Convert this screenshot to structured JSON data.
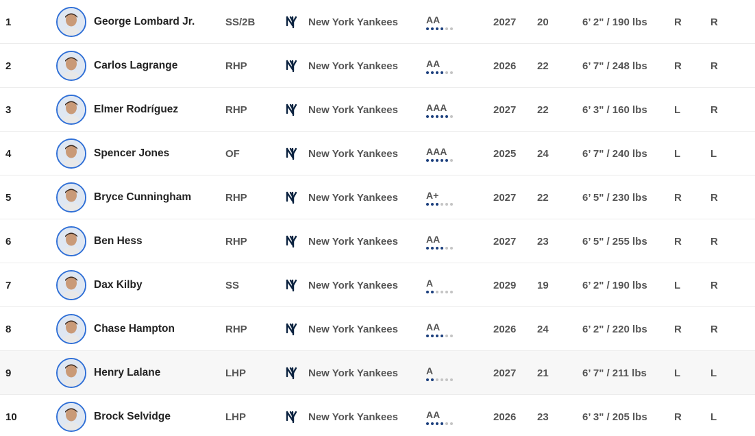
{
  "colors": {
    "avatar_border": "#2f6fd6",
    "dot_active": "#1b3f7d",
    "dot_inactive": "#c4c4c4",
    "row_highlight": "#f7f7f7",
    "team_logo": "#0c2340"
  },
  "icons": {
    "avatar": "player-headshot-icon",
    "team_logo": "new-york-yankees-logo-icon"
  },
  "prospects": [
    {
      "rank": "1",
      "name": "George Lombard Jr.",
      "position": "SS/2B",
      "team": "New York Yankees",
      "level": "AA",
      "level_progress": 4,
      "eta": "2027",
      "age": "20",
      "height_weight": "6’ 2\" / 190 lbs",
      "bats": "R",
      "throws": "R"
    },
    {
      "rank": "2",
      "name": "Carlos Lagrange",
      "position": "RHP",
      "team": "New York Yankees",
      "level": "AA",
      "level_progress": 4,
      "eta": "2026",
      "age": "22",
      "height_weight": "6’ 7\" / 248 lbs",
      "bats": "R",
      "throws": "R"
    },
    {
      "rank": "3",
      "name": "Elmer Rodríguez",
      "position": "RHP",
      "team": "New York Yankees",
      "level": "AAA",
      "level_progress": 5,
      "eta": "2027",
      "age": "22",
      "height_weight": "6’ 3\" / 160 lbs",
      "bats": "L",
      "throws": "R"
    },
    {
      "rank": "4",
      "name": "Spencer Jones",
      "position": "OF",
      "team": "New York Yankees",
      "level": "AAA",
      "level_progress": 5,
      "eta": "2025",
      "age": "24",
      "height_weight": "6’ 7\" / 240 lbs",
      "bats": "L",
      "throws": "L"
    },
    {
      "rank": "5",
      "name": "Bryce Cunningham",
      "position": "RHP",
      "team": "New York Yankees",
      "level": "A+",
      "level_progress": 3,
      "eta": "2027",
      "age": "22",
      "height_weight": "6’ 5\" / 230 lbs",
      "bats": "R",
      "throws": "R"
    },
    {
      "rank": "6",
      "name": "Ben Hess",
      "position": "RHP",
      "team": "New York Yankees",
      "level": "AA",
      "level_progress": 4,
      "eta": "2027",
      "age": "23",
      "height_weight": "6’ 5\" / 255 lbs",
      "bats": "R",
      "throws": "R"
    },
    {
      "rank": "7",
      "name": "Dax Kilby",
      "position": "SS",
      "team": "New York Yankees",
      "level": "A",
      "level_progress": 2,
      "eta": "2029",
      "age": "19",
      "height_weight": "6’ 2\" / 190 lbs",
      "bats": "L",
      "throws": "R"
    },
    {
      "rank": "8",
      "name": "Chase Hampton",
      "position": "RHP",
      "team": "New York Yankees",
      "level": "AA",
      "level_progress": 4,
      "eta": "2026",
      "age": "24",
      "height_weight": "6’ 2\" / 220 lbs",
      "bats": "R",
      "throws": "R"
    },
    {
      "rank": "9",
      "name": "Henry Lalane",
      "position": "LHP",
      "team": "New York Yankees",
      "level": "A",
      "level_progress": 2,
      "eta": "2027",
      "age": "21",
      "height_weight": "6’ 7\" / 211 lbs",
      "bats": "L",
      "throws": "L",
      "highlighted": true
    },
    {
      "rank": "10",
      "name": "Brock Selvidge",
      "position": "LHP",
      "team": "New York Yankees",
      "level": "AA",
      "level_progress": 4,
      "eta": "2026",
      "age": "23",
      "height_weight": "6’ 3\" / 205 lbs",
      "bats": "R",
      "throws": "L"
    }
  ]
}
